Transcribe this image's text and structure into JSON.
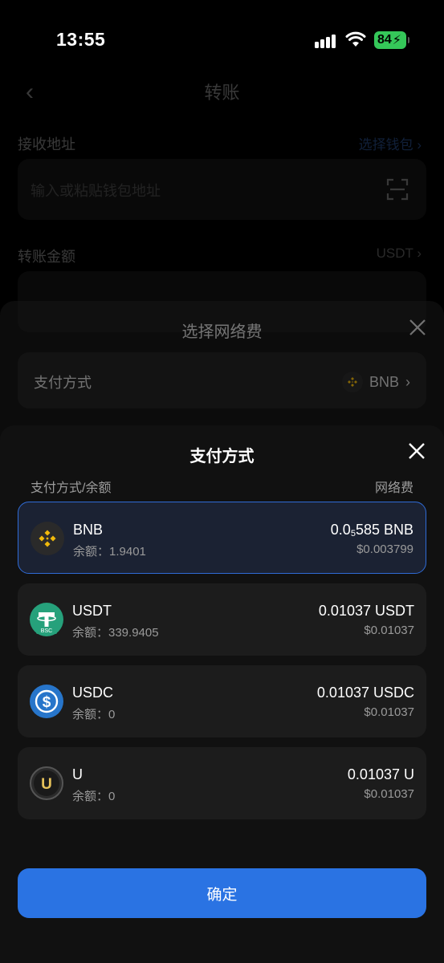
{
  "status_bar": {
    "time": "13:55",
    "battery": "84"
  },
  "transfer_page": {
    "title": "转账",
    "receive_label": "接收地址",
    "select_wallet": "选择钱包 ›",
    "address_placeholder": "输入或粘贴钱包地址",
    "amount_label": "转账金额",
    "amount_unit": "USDT ›"
  },
  "network_fee_sheet": {
    "title": "选择网络费",
    "pay_method_label": "支付方式",
    "pay_method_value": "BNB"
  },
  "payment_sheet": {
    "title": "支付方式",
    "col_left": "支付方式/余额",
    "col_right": "网络费",
    "options": [
      {
        "name": "BNB",
        "balance": "余额：1.9401",
        "fee_pre": "0.0",
        "fee_sub": "5",
        "fee_post": "585 BNB",
        "fee_usd": "$0.003799"
      },
      {
        "name": "USDT",
        "balance": "余额：339.9405",
        "fee": "0.01037 USDT",
        "fee_usd": "$0.01037"
      },
      {
        "name": "USDC",
        "balance": "余额：0",
        "fee": "0.01037 USDC",
        "fee_usd": "$0.01037"
      },
      {
        "name": "U",
        "balance": "余额：0",
        "fee": "0.01037 U",
        "fee_usd": "$0.01037"
      }
    ],
    "confirm": "确定"
  },
  "icons": {
    "bnb": "bnb-logo-icon",
    "usdt": "tether-logo-icon",
    "usdc": "usdc-logo-icon",
    "u": "u-logo-icon",
    "usdt_badge": "BSC"
  },
  "colors": {
    "accent": "#2a73e3",
    "bnb": "#f0b90b",
    "usdt": "#26a17b",
    "usdc": "#2775ca"
  }
}
